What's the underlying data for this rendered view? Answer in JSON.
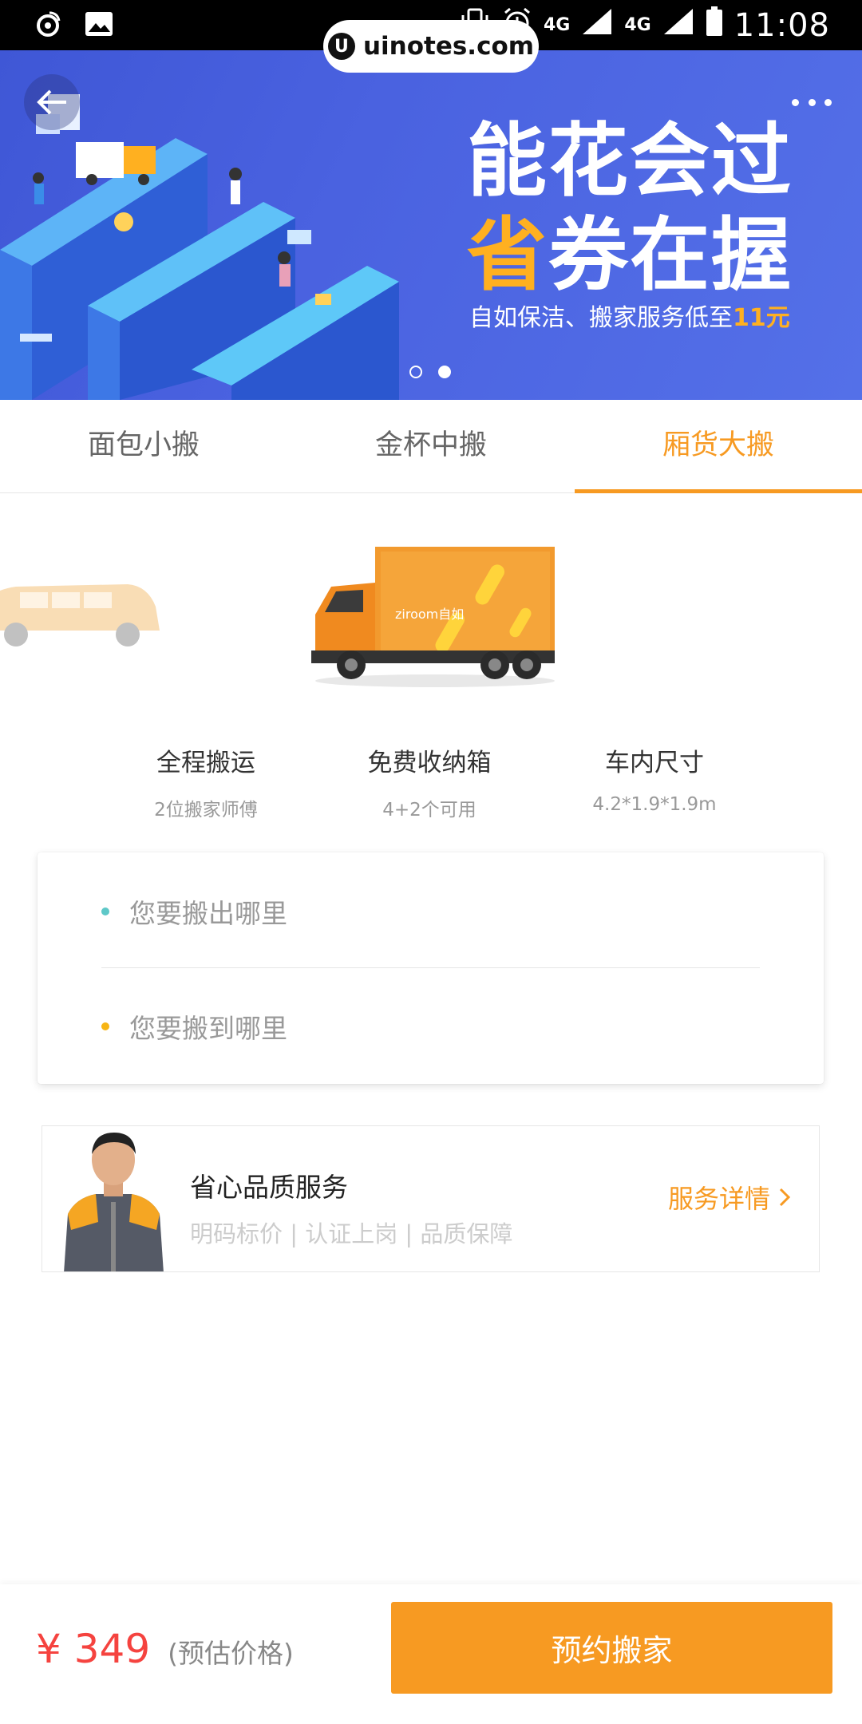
{
  "status_bar": {
    "time": "11:08",
    "network_1": "4G",
    "network_2": "4G"
  },
  "watermark": {
    "logo": "U",
    "text": "uinotes.com"
  },
  "banner": {
    "headline_line1": "能花会过",
    "headline_line2_orange": "省",
    "headline_line2_rest": "券在握",
    "subtitle_prefix": "自如保洁、搬家服务低至",
    "subtitle_highlight": "11元",
    "carousel_total": 2,
    "carousel_active_index": 1,
    "back_icon": "arrow-left-icon",
    "more_icon": "more-dots-icon"
  },
  "tabs": [
    {
      "label": "面包小搬",
      "active": false
    },
    {
      "label": "金杯中搬",
      "active": false
    },
    {
      "label": "厢货大搬",
      "active": true
    }
  ],
  "vehicle": {
    "brand_text": "ziroom自如"
  },
  "features": [
    {
      "title": "全程搬运",
      "sub": "2位搬家师傅"
    },
    {
      "title": "免费收纳箱",
      "sub": "4+2个可用"
    },
    {
      "title": "车内尺寸",
      "sub": "4.2*1.9*1.9m"
    }
  ],
  "address": {
    "from_placeholder": "您要搬出哪里",
    "to_placeholder": "您要搬到哪里",
    "from_dot_color": "#5ec8c8",
    "to_dot_color": "#f7b515"
  },
  "service": {
    "title": "省心品质服务",
    "subtitle": "明码标价 | 认证上岗 | 品质保障",
    "link_label": "服务详情"
  },
  "bottom": {
    "price": "¥ 349",
    "price_note": "(预估价格)",
    "book_label": "预约搬家"
  },
  "colors": {
    "accent": "#f79a22",
    "price": "#f5433f",
    "banner_blue": "#4a62e0"
  }
}
